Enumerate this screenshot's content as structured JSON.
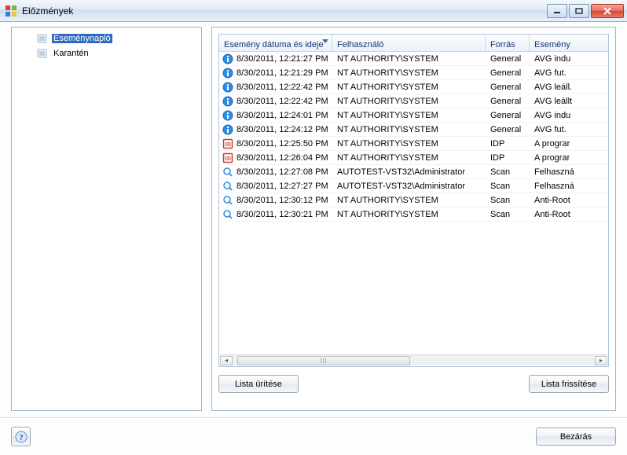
{
  "window": {
    "title": "Előzmények"
  },
  "tree": {
    "items": [
      {
        "label": "Eseménynapló",
        "selected": true
      },
      {
        "label": "Karantén",
        "selected": false
      }
    ]
  },
  "grid": {
    "columns": [
      {
        "label": "Esemény dátuma és ideje",
        "sorted": true
      },
      {
        "label": "Felhasználó"
      },
      {
        "label": "Forrás"
      },
      {
        "label": "Esemény"
      }
    ],
    "rows": [
      {
        "icon": "info",
        "date": "8/30/2011, 12:21:27 PM",
        "user": "NT AUTHORITY\\SYSTEM",
        "source": "General",
        "event": "AVG indu"
      },
      {
        "icon": "info",
        "date": "8/30/2011, 12:21:29 PM",
        "user": "NT AUTHORITY\\SYSTEM",
        "source": "General",
        "event": "AVG fut."
      },
      {
        "icon": "info",
        "date": "8/30/2011, 12:22:42 PM",
        "user": "NT AUTHORITY\\SYSTEM",
        "source": "General",
        "event": "AVG leáll."
      },
      {
        "icon": "info",
        "date": "8/30/2011, 12:22:42 PM",
        "user": "NT AUTHORITY\\SYSTEM",
        "source": "General",
        "event": "AVG leállt"
      },
      {
        "icon": "info",
        "date": "8/30/2011, 12:24:01 PM",
        "user": "NT AUTHORITY\\SYSTEM",
        "source": "General",
        "event": "AVG indu"
      },
      {
        "icon": "info",
        "date": "8/30/2011, 12:24:12 PM",
        "user": "NT AUTHORITY\\SYSTEM",
        "source": "General",
        "event": "AVG fut."
      },
      {
        "icon": "idp",
        "date": "8/30/2011, 12:25:50 PM",
        "user": "NT AUTHORITY\\SYSTEM",
        "source": "IDP",
        "event": "A prograr"
      },
      {
        "icon": "idp",
        "date": "8/30/2011, 12:26:04 PM",
        "user": "NT AUTHORITY\\SYSTEM",
        "source": "IDP",
        "event": "A prograr"
      },
      {
        "icon": "scan",
        "date": "8/30/2011, 12:27:08 PM",
        "user": "AUTOTEST-VST32\\Administrator",
        "source": "Scan",
        "event": "Felhaszná"
      },
      {
        "icon": "scan",
        "date": "8/30/2011, 12:27:27 PM",
        "user": "AUTOTEST-VST32\\Administrator",
        "source": "Scan",
        "event": "Felhaszná"
      },
      {
        "icon": "scan",
        "date": "8/30/2011, 12:30:12 PM",
        "user": "NT AUTHORITY\\SYSTEM",
        "source": "Scan",
        "event": "Anti-Root"
      },
      {
        "icon": "scan",
        "date": "8/30/2011, 12:30:21 PM",
        "user": "NT AUTHORITY\\SYSTEM",
        "source": "Scan",
        "event": "Anti-Root"
      }
    ]
  },
  "buttons": {
    "clear_list": "Lista ürítése",
    "refresh_list": "Lista frissítése",
    "close": "Bezárás"
  }
}
